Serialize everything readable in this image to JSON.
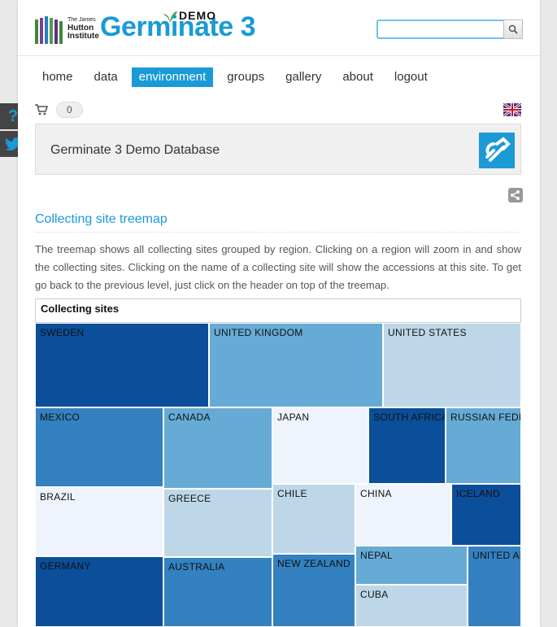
{
  "header": {
    "hutton_line1": "The James",
    "hutton_line2": "Hutton",
    "hutton_line3": "Institute",
    "app_name": "Germinate",
    "app_version": "3",
    "demo_tag": "DEMO",
    "search_placeholder": ""
  },
  "nav": {
    "items": [
      {
        "label": "home"
      },
      {
        "label": "data"
      },
      {
        "label": "environment"
      },
      {
        "label": "groups"
      },
      {
        "label": "gallery"
      },
      {
        "label": "about"
      },
      {
        "label": "logout"
      }
    ],
    "active": "environment"
  },
  "cart": {
    "count": "0"
  },
  "banner": {
    "title": "Germinate 3 Demo Database"
  },
  "section": {
    "title": "Collecting site treemap",
    "description": "The treemap shows all collecting sites grouped by region. Clicking on a region will zoom in and show the collecting sites. Clicking on the name of a collecting site will show the accessions at this site. To get go back to the previous level, just click on the header on top of the treemap."
  },
  "treemap": {
    "header": "Collecting sites",
    "cells": [
      {
        "label": "SWEDEN",
        "shade": 1
      },
      {
        "label": "UNITED KINGDOM",
        "shade": 3
      },
      {
        "label": "UNITED STATES",
        "shade": 4
      },
      {
        "label": "MEXICO",
        "shade": 2
      },
      {
        "label": "CANADA",
        "shade": 3
      },
      {
        "label": "JAPAN",
        "shade": 5
      },
      {
        "label": "SOUTH AFRICA",
        "shade": 1
      },
      {
        "label": "RUSSIAN FEDE",
        "shade": 3
      },
      {
        "label": "BRAZIL",
        "shade": 5
      },
      {
        "label": "GREECE",
        "shade": 4
      },
      {
        "label": "CHILE",
        "shade": 4
      },
      {
        "label": "CHINA",
        "shade": 5
      },
      {
        "label": "ICELAND",
        "shade": 1
      },
      {
        "label": "GERMANY",
        "shade": 1
      },
      {
        "label": "AUSTRALIA",
        "shade": 2
      },
      {
        "label": "NEW ZEALAND",
        "shade": 2
      },
      {
        "label": "NEPAL",
        "shade": 3
      },
      {
        "label": "UNITED AR",
        "shade": 2
      },
      {
        "label": "CUBA",
        "shade": 4
      }
    ]
  },
  "colors": {
    "accent": "#1a9ad6",
    "shade_1": "#0b4e9a",
    "shade_2": "#3381c0",
    "shade_3": "#66abd6",
    "shade_4": "#bed7e8",
    "shade_5": "#eef3fc"
  },
  "icons": {
    "search": "search-icon",
    "help": "question-icon",
    "twitter": "twitter-icon",
    "cart": "cart-icon",
    "flag": "uk-flag-icon",
    "share": "share-icon",
    "db": "germinate-db-icon"
  }
}
